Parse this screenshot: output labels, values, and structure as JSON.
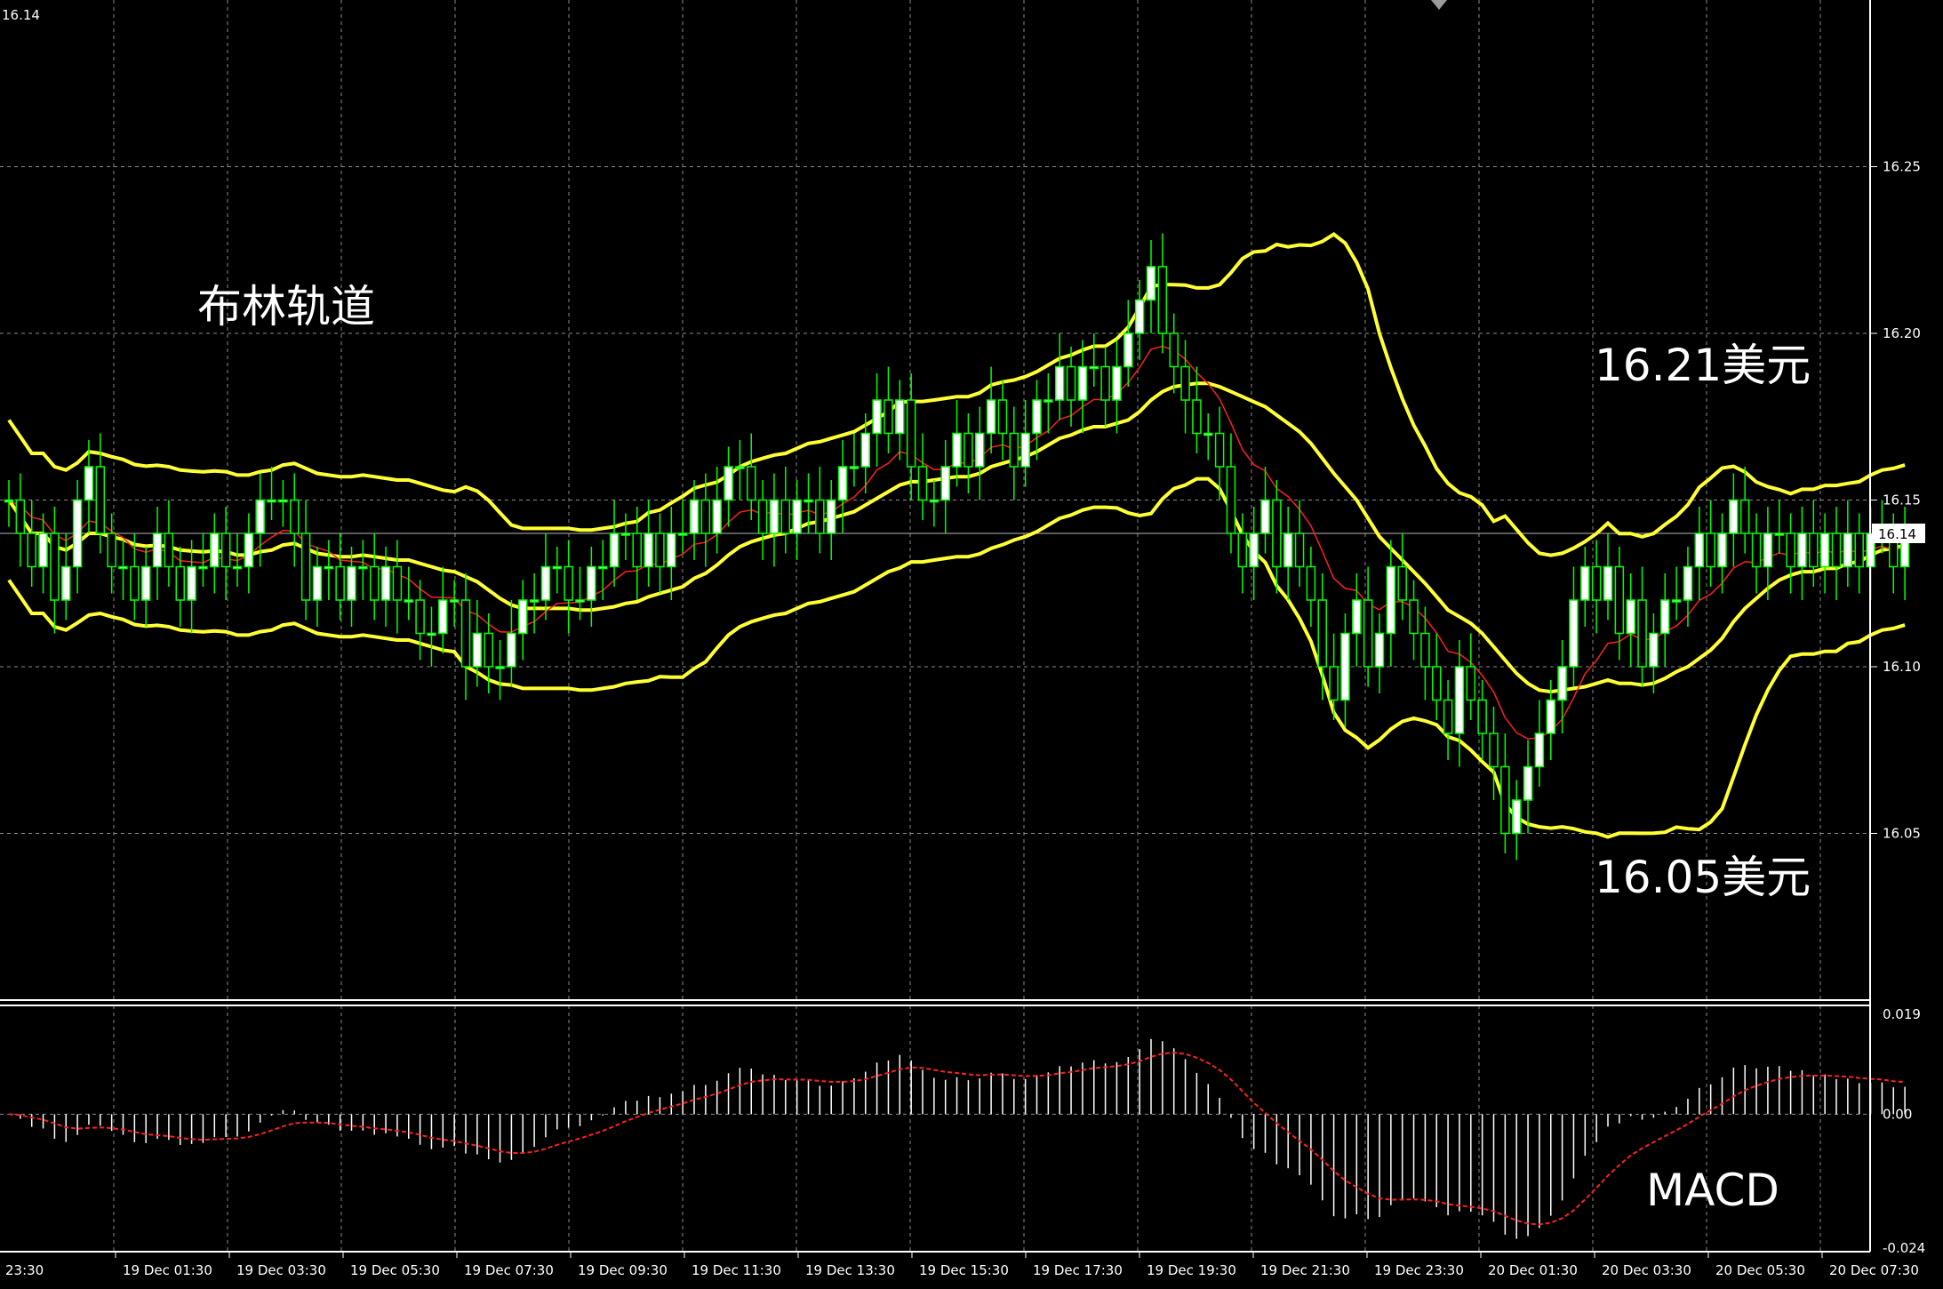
{
  "chart_data": {
    "type": "candlestick",
    "corner_label": "16.14",
    "annotations": {
      "indicator_name": "布林轨道",
      "upper_label": "16.21美元",
      "lower_label": "16.05美元",
      "macd_label": "MACD"
    },
    "price_axis": {
      "ylim": [
        16.0,
        16.3
      ],
      "ticks": [
        "16.25",
        "16.20",
        "16.15",
        "16.10",
        "16.05"
      ],
      "current_price": 16.14,
      "current_label": "16.14"
    },
    "macd_axis": {
      "ylim": [
        -0.024,
        0.019
      ],
      "ticks": [
        "0.019",
        "0.00",
        "-0.024"
      ]
    },
    "x_labels": [
      "23:30",
      "19 Dec 01:30",
      "19 Dec 03:30",
      "19 Dec 05:30",
      "19 Dec 07:30",
      "19 Dec 09:30",
      "19 Dec 11:30",
      "19 Dec 13:30",
      "19 Dec 15:30",
      "19 Dec 17:30",
      "19 Dec 19:30",
      "19 Dec 21:30",
      "19 Dec 23:30",
      "20 Dec 01:30",
      "20 Dec 03:30",
      "20 Dec 05:30",
      "20 Dec 07:30"
    ],
    "grid": true,
    "colors": {
      "background": "#000000",
      "grid": "#8a8a8a",
      "bull_candle": "#ffffff",
      "bear_candle": "#000000",
      "wick": "#00ff00",
      "bollinger": "#ffff33",
      "moving_average": "#ff2020",
      "macd_bar": "#ffffff",
      "macd_signal": "#ff2020"
    },
    "closes": [
      16.15,
      16.14,
      16.13,
      16.14,
      16.12,
      16.13,
      16.15,
      16.16,
      16.14,
      16.13,
      16.13,
      16.12,
      16.13,
      16.14,
      16.13,
      16.12,
      16.13,
      16.13,
      16.14,
      16.13,
      16.13,
      16.14,
      16.15,
      16.15,
      16.15,
      16.14,
      16.12,
      16.13,
      16.13,
      16.12,
      16.13,
      16.13,
      16.12,
      16.13,
      16.12,
      16.12,
      16.11,
      16.11,
      16.12,
      16.12,
      16.1,
      16.11,
      16.1,
      16.1,
      16.11,
      16.12,
      16.12,
      16.13,
      16.13,
      16.12,
      16.12,
      16.13,
      16.13,
      16.14,
      16.14,
      16.13,
      16.14,
      16.13,
      16.14,
      16.14,
      16.15,
      16.14,
      16.15,
      16.16,
      16.16,
      16.15,
      16.14,
      16.15,
      16.14,
      16.15,
      16.15,
      16.14,
      16.15,
      16.16,
      16.16,
      16.17,
      16.18,
      16.17,
      16.18,
      16.16,
      16.15,
      16.15,
      16.16,
      16.17,
      16.16,
      16.17,
      16.18,
      16.17,
      16.16,
      16.17,
      16.18,
      16.18,
      16.19,
      16.18,
      16.19,
      16.19,
      16.18,
      16.19,
      16.2,
      16.21,
      16.22,
      16.2,
      16.19,
      16.18,
      16.17,
      16.17,
      16.16,
      16.14,
      16.13,
      16.14,
      16.15,
      16.13,
      16.14,
      16.13,
      16.12,
      16.1,
      16.09,
      16.11,
      16.12,
      16.1,
      16.11,
      16.13,
      16.12,
      16.11,
      16.1,
      16.09,
      16.08,
      16.1,
      16.09,
      16.08,
      16.07,
      16.05,
      16.06,
      16.07,
      16.08,
      16.09,
      16.1,
      16.12,
      16.13,
      16.12,
      16.13,
      16.11,
      16.12,
      16.1,
      16.11,
      16.12,
      16.12,
      16.13,
      16.14,
      16.13,
      16.14,
      16.15,
      16.14,
      16.13,
      16.14,
      16.14,
      16.13,
      16.14,
      16.13,
      16.14,
      16.13,
      16.14,
      16.13,
      16.14,
      16.14,
      16.13,
      16.14
    ]
  }
}
